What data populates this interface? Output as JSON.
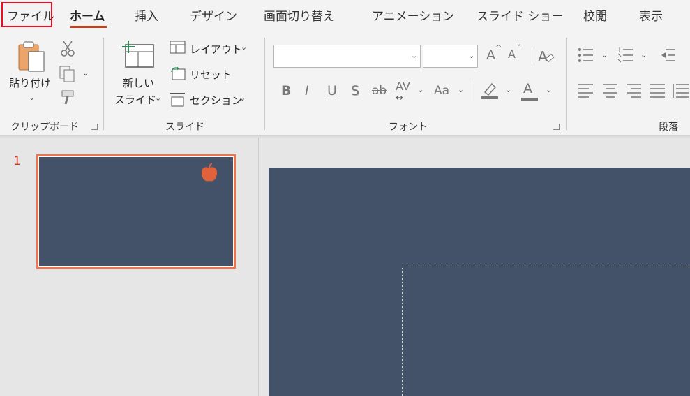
{
  "tabs": [
    {
      "label": "ファイル",
      "active": false
    },
    {
      "label": "ホーム",
      "active": true
    },
    {
      "label": "挿入",
      "active": false
    },
    {
      "label": "デザイン",
      "active": false
    },
    {
      "label": "画面切り替え",
      "active": false
    },
    {
      "label": "アニメーション",
      "active": false
    },
    {
      "label": "スライド ショー",
      "active": false
    },
    {
      "label": "校閲",
      "active": false
    },
    {
      "label": "表示",
      "active": false
    }
  ],
  "clipboard": {
    "paste_label": "貼り付け",
    "group_label": "クリップボード"
  },
  "slides_group": {
    "new_slide_line1": "新しい",
    "new_slide_line2": "スライド",
    "layout_label": "レイアウト",
    "reset_label": "リセット",
    "section_label": "セクション",
    "group_label": "スライド"
  },
  "font_group": {
    "font_name": "",
    "font_size": "",
    "bold": "B",
    "italic": "I",
    "underline": "U",
    "shadow": "S",
    "strikethrough": "ab",
    "spacing": "AV",
    "change_case": "Aa",
    "font_color": "A",
    "grow": "A",
    "shrink": "A",
    "group_label": "フォント"
  },
  "paragraph_group": {
    "group_label": "段落"
  },
  "slide_panel": {
    "slide_number": "1"
  },
  "colors": {
    "accent": "#c43e1c",
    "slide_bg": "#435269",
    "thumb_border": "#e9764f",
    "highlight_box": "#e81123",
    "apple": "#e0613a"
  }
}
